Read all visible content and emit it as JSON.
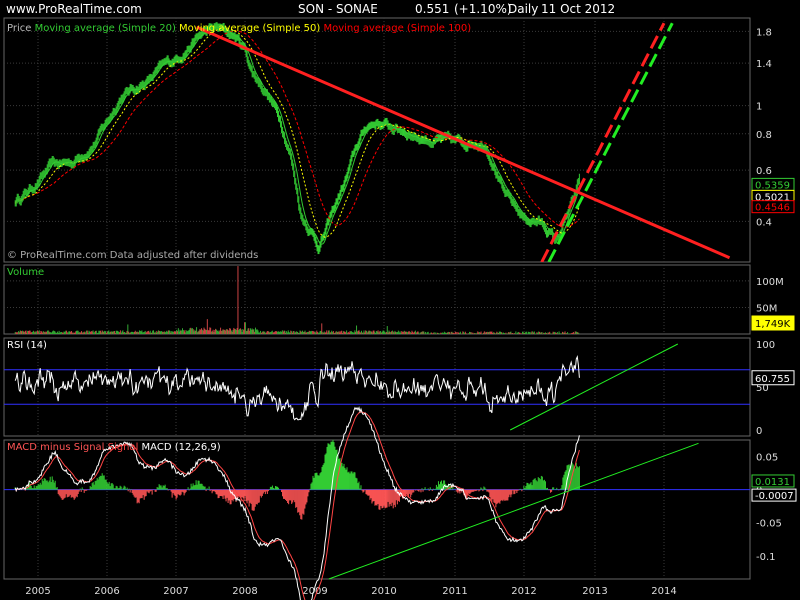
{
  "header": {
    "site": "www.ProRealTime.com",
    "symbol": "SON - SONAE",
    "price": "0.551",
    "change": "(+1.10%)",
    "period": "Daily",
    "date": "11 Oct 2012"
  },
  "colors": {
    "background": "#000000",
    "grid": "#3a3a3a",
    "price": "#33cc33",
    "ma20": "#33cc33",
    "ma50": "#ffff00",
    "ma100": "#ff0000",
    "trend_red": "#ff2020",
    "trend_green": "#22ee22",
    "rsi_line": "#ffffff",
    "rsi_levels": "#3030ff",
    "macd_line": "#ffffff",
    "signal_line": "#ff4444",
    "histogram_pos": "#33cc33",
    "histogram_neg": "#ff5555",
    "volume_bar": "#33aa33"
  },
  "chart_data": [
    {
      "type": "line",
      "panel": "price",
      "legend": [
        "Price",
        "Moving average (Simple 20)",
        "Moving average (Simple 50)",
        "Moving average (Simple 100)"
      ],
      "footnote": "© ProRealTime.com  Data adjusted after dividends",
      "x_ticks": [
        "2005",
        "2006",
        "2007",
        "2008",
        "2009",
        "2010",
        "2011",
        "2012",
        "2013",
        "2014"
      ],
      "y_scale": "log",
      "ylim": [
        0.29,
        2.0
      ],
      "y_ticks": [
        0.4,
        0.6,
        0.8,
        1,
        1.4,
        1.8
      ],
      "y_tick_labels": [
        "0.4",
        "0.6",
        "0.8",
        "1",
        "1.4",
        "1.8"
      ],
      "price_anchors": [
        [
          2004.67,
          0.47
        ],
        [
          2004.9,
          0.52
        ],
        [
          2005.2,
          0.62
        ],
        [
          2005.5,
          0.64
        ],
        [
          2005.8,
          0.74
        ],
        [
          2006.0,
          0.88
        ],
        [
          2006.2,
          1.08
        ],
        [
          2006.4,
          1.15
        ],
        [
          2006.6,
          1.22
        ],
        [
          2006.8,
          1.35
        ],
        [
          2007.0,
          1.45
        ],
        [
          2007.2,
          1.62
        ],
        [
          2007.4,
          1.78
        ],
        [
          2007.6,
          1.84
        ],
        [
          2007.85,
          1.73
        ],
        [
          2008.0,
          1.55
        ],
        [
          2008.1,
          1.3
        ],
        [
          2008.3,
          1.12
        ],
        [
          2008.5,
          0.9
        ],
        [
          2008.65,
          0.68
        ],
        [
          2008.8,
          0.42
        ],
        [
          2008.95,
          0.37
        ],
        [
          2009.05,
          0.33
        ],
        [
          2009.15,
          0.37
        ],
        [
          2009.3,
          0.46
        ],
        [
          2009.45,
          0.56
        ],
        [
          2009.6,
          0.72
        ],
        [
          2009.75,
          0.85
        ],
        [
          2009.9,
          0.88
        ],
        [
          2010.1,
          0.84
        ],
        [
          2010.3,
          0.82
        ],
        [
          2010.5,
          0.78
        ],
        [
          2010.7,
          0.76
        ],
        [
          2010.9,
          0.75
        ],
        [
          2011.1,
          0.74
        ],
        [
          2011.3,
          0.76
        ],
        [
          2011.45,
          0.74
        ],
        [
          2011.6,
          0.6
        ],
        [
          2011.7,
          0.5
        ],
        [
          2011.85,
          0.45
        ],
        [
          2012.0,
          0.41
        ],
        [
          2012.2,
          0.4
        ],
        [
          2012.35,
          0.37
        ],
        [
          2012.45,
          0.34
        ],
        [
          2012.55,
          0.39
        ],
        [
          2012.7,
          0.47
        ],
        [
          2012.78,
          0.551
        ]
      ],
      "trendlines": [
        {
          "name": "Resistance",
          "from": [
            2007.3,
            1.86
          ],
          "to": [
            2014.95,
            0.3
          ],
          "dashed": false
        },
        {
          "name": "Support red",
          "from": [
            2012.25,
            0.29
          ],
          "to": [
            2014.0,
            1.92
          ],
          "dashed": true
        },
        {
          "name": "Support green",
          "from": [
            2012.35,
            0.29
          ],
          "to": [
            2014.12,
            1.92
          ],
          "dashed": true
        }
      ],
      "value_labels": [
        {
          "text": "0.5359",
          "value": 0.536
        },
        {
          "text": "0.5021",
          "value": 0.502
        },
        {
          "text": "0.4546",
          "value": 0.4546
        }
      ]
    },
    {
      "type": "bar",
      "panel": "volume",
      "legend": [
        "Volume"
      ],
      "y_ticks": [
        50,
        100
      ],
      "y_tick_labels": [
        "50M",
        "100M"
      ],
      "ylim": [
        0,
        130
      ],
      "spikes": [
        [
          2006.3,
          18
        ],
        [
          2007.45,
          28
        ],
        [
          2007.9,
          128
        ],
        [
          2008.0,
          22
        ],
        [
          2009.1,
          20
        ],
        [
          2009.6,
          16
        ],
        [
          2010.05,
          15
        ]
      ],
      "last_value_label": "1,749K"
    },
    {
      "type": "line",
      "panel": "rsi",
      "legend": [
        "RSI (14)"
      ],
      "ylim": [
        0,
        100
      ],
      "y_ticks": [
        0,
        50,
        100
      ],
      "y_tick_labels": [
        "0",
        "50",
        "100"
      ],
      "levels": [
        70,
        30
      ],
      "last_value_label": "60.755",
      "trendline": {
        "from": [
          2011.8,
          0
        ],
        "to": [
          2014.2,
          100
        ]
      }
    },
    {
      "type": "line",
      "panel": "macd",
      "legend": [
        "MACD minus Signal",
        "Signal",
        "MACD (12,26,9)"
      ],
      "ylim": [
        -0.135,
        0.075
      ],
      "y_ticks": [
        0.05,
        0,
        -0.05,
        -0.1
      ],
      "y_tick_labels": [
        "0.05",
        "0",
        "-0.05",
        "-0.1"
      ],
      "value_labels": [
        {
          "text": "0.0131",
          "value": 0.0131
        },
        {
          "text": "-0.0007",
          "value": -0.0007
        }
      ],
      "trendline": {
        "from": [
          2009.2,
          -0.135
        ],
        "to": [
          2014.5,
          0.07
        ]
      }
    }
  ]
}
